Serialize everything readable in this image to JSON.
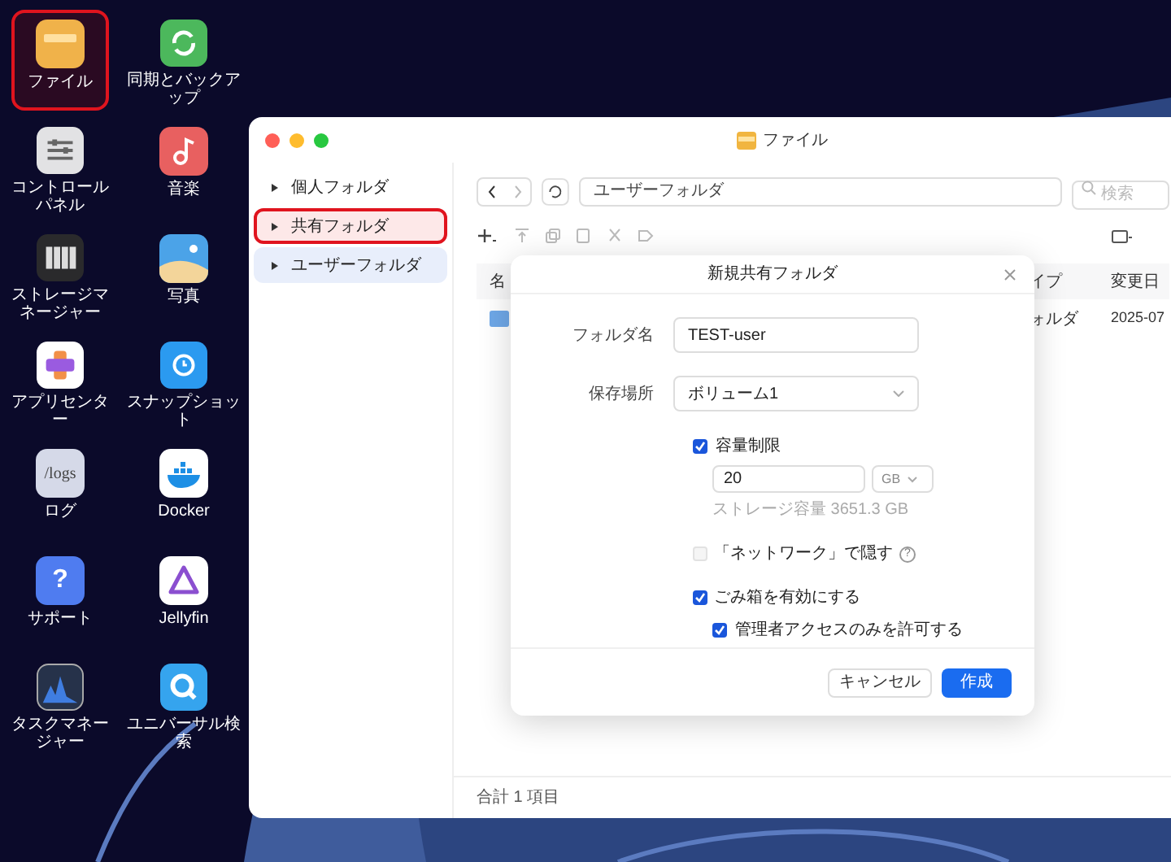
{
  "desktop_icons": [
    {
      "label": "ファイル",
      "kind": "files",
      "highlighted": true
    },
    {
      "label": "同期とバックアップ",
      "kind": "sync",
      "highlighted": false
    },
    {
      "label": "コントロールパネル",
      "kind": "control",
      "highlighted": false
    },
    {
      "label": "音楽",
      "kind": "music",
      "highlighted": false
    },
    {
      "label": "ストレージマネージャー",
      "kind": "storage",
      "highlighted": false
    },
    {
      "label": "写真",
      "kind": "photos",
      "highlighted": false
    },
    {
      "label": "アプリセンター",
      "kind": "apps",
      "highlighted": false
    },
    {
      "label": "スナップショット",
      "kind": "snapshot",
      "highlighted": false
    },
    {
      "label": "ログ",
      "kind": "logs",
      "highlighted": false,
      "icon_text": "/logs"
    },
    {
      "label": "Docker",
      "kind": "docker",
      "highlighted": false
    },
    {
      "label": "サポート",
      "kind": "support",
      "highlighted": false,
      "icon_text": "?"
    },
    {
      "label": "Jellyfin",
      "kind": "jellyfin",
      "highlighted": false
    },
    {
      "label": "タスクマネージャー",
      "kind": "tasks",
      "highlighted": false
    },
    {
      "label": "ユニバーサル検索",
      "kind": "search",
      "highlighted": false
    }
  ],
  "window": {
    "title": "ファイル"
  },
  "sidebar": {
    "items": [
      {
        "label": "個人フォルダ",
        "selected": false,
        "highlighted": false
      },
      {
        "label": "共有フォルダ",
        "selected": false,
        "highlighted": true
      },
      {
        "label": "ユーザーフォルダ",
        "selected": true,
        "highlighted": false
      }
    ]
  },
  "path": "ユーザーフォルダ",
  "search": {
    "placeholder": "検索"
  },
  "table": {
    "columns": [
      "名",
      "イプ",
      "変更日"
    ],
    "rows": [
      {
        "type": "ォルダ",
        "modified": "2025-07"
      }
    ]
  },
  "status_bar": "合計 1 項目",
  "dialog": {
    "title": "新規共有フォルダ",
    "fields": [
      {
        "label": "フォルダ名",
        "kind": "text",
        "value": "TEST-user"
      },
      {
        "label": "保存場所",
        "kind": "select",
        "value": "ボリューム1"
      }
    ],
    "quota": {
      "label": "容量制限",
      "checked": true,
      "value": "20",
      "unit": "GB",
      "hint": "ストレージ容量 3651.3 GB"
    },
    "options": [
      {
        "label": "「ネットワーク」で隠す",
        "checked": false,
        "disabled": true,
        "help": "?"
      },
      {
        "label": "ごみ箱を有効にする",
        "checked": true,
        "disabled": false,
        "children": [
          {
            "label": "管理者アクセスのみを許可する",
            "checked": true
          }
        ]
      }
    ],
    "buttons": [
      {
        "label": "キャンセル",
        "kind": "secondary"
      },
      {
        "label": "作成",
        "kind": "primary"
      }
    ]
  }
}
